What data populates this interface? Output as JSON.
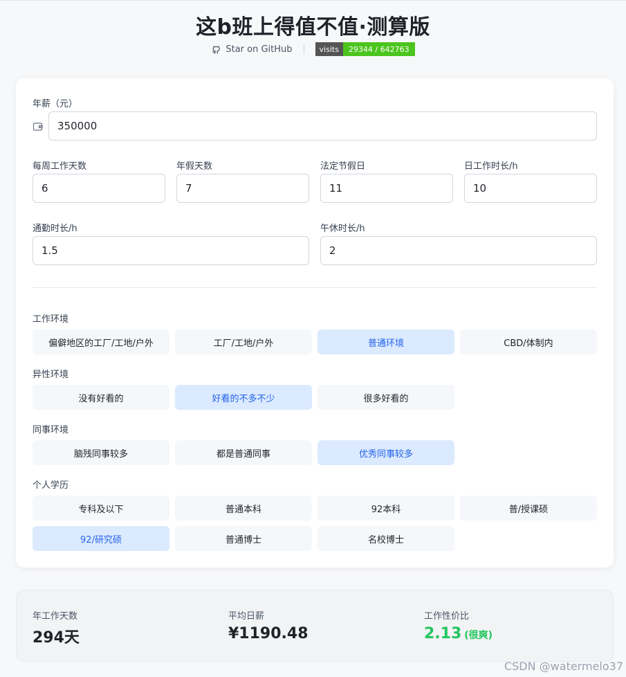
{
  "header": {
    "title": "这b班上得值不值·测算版",
    "github_label": "Star on  GitHub",
    "badge_label": "visits",
    "badge_value": "29344 / 642763"
  },
  "form": {
    "salary": {
      "label": "年薪（元）",
      "value": "350000"
    },
    "work_days": {
      "label": "每周工作天数",
      "value": "6"
    },
    "annual_leave": {
      "label": "年假天数",
      "value": "7"
    },
    "holidays": {
      "label": "法定节假日",
      "value": "11"
    },
    "daily_hours": {
      "label": "日工作时长/h",
      "value": "10"
    },
    "commute": {
      "label": "通勤时长/h",
      "value": "1.5"
    },
    "lunch_break": {
      "label": "午休时长/h",
      "value": "2"
    }
  },
  "groups": {
    "environment": {
      "label": "工作环境",
      "options": [
        "偏僻地区的工厂/工地/户外",
        "工厂/工地/户外",
        "普通环境",
        "CBD/体制内"
      ],
      "selected": "普通环境"
    },
    "opposite_sex": {
      "label": "异性环境",
      "options": [
        "没有好看的",
        "好看的不多不少",
        "很多好看的"
      ],
      "selected": "好看的不多不少"
    },
    "colleagues": {
      "label": "同事环境",
      "options": [
        "脑残同事较多",
        "都是普通同事",
        "优秀同事较多"
      ],
      "selected": "优秀同事较多"
    },
    "education": {
      "label": "个人学历",
      "options": [
        "专科及以下",
        "普通本科",
        "92本科",
        "普/授课硕",
        "92/研究硕",
        "普通博士",
        "名校博士"
      ],
      "selected": "92/研究硕"
    }
  },
  "results": {
    "annual_days": {
      "label": "年工作天数",
      "value": "294天"
    },
    "daily_pay": {
      "label": "平均日薪",
      "value": "¥1190.48"
    },
    "ratio": {
      "label": "工作性价比",
      "value": "2.13",
      "note": "(很爽)"
    }
  },
  "watermark": "CSDN @watermelo37",
  "colors": {
    "accent": "#2563eb",
    "selected_bg": "#dbeafe",
    "good": "#22c55e",
    "badge_green": "#4bc51d"
  },
  "icons": {
    "github": "github-icon",
    "wallet": "wallet-icon"
  }
}
